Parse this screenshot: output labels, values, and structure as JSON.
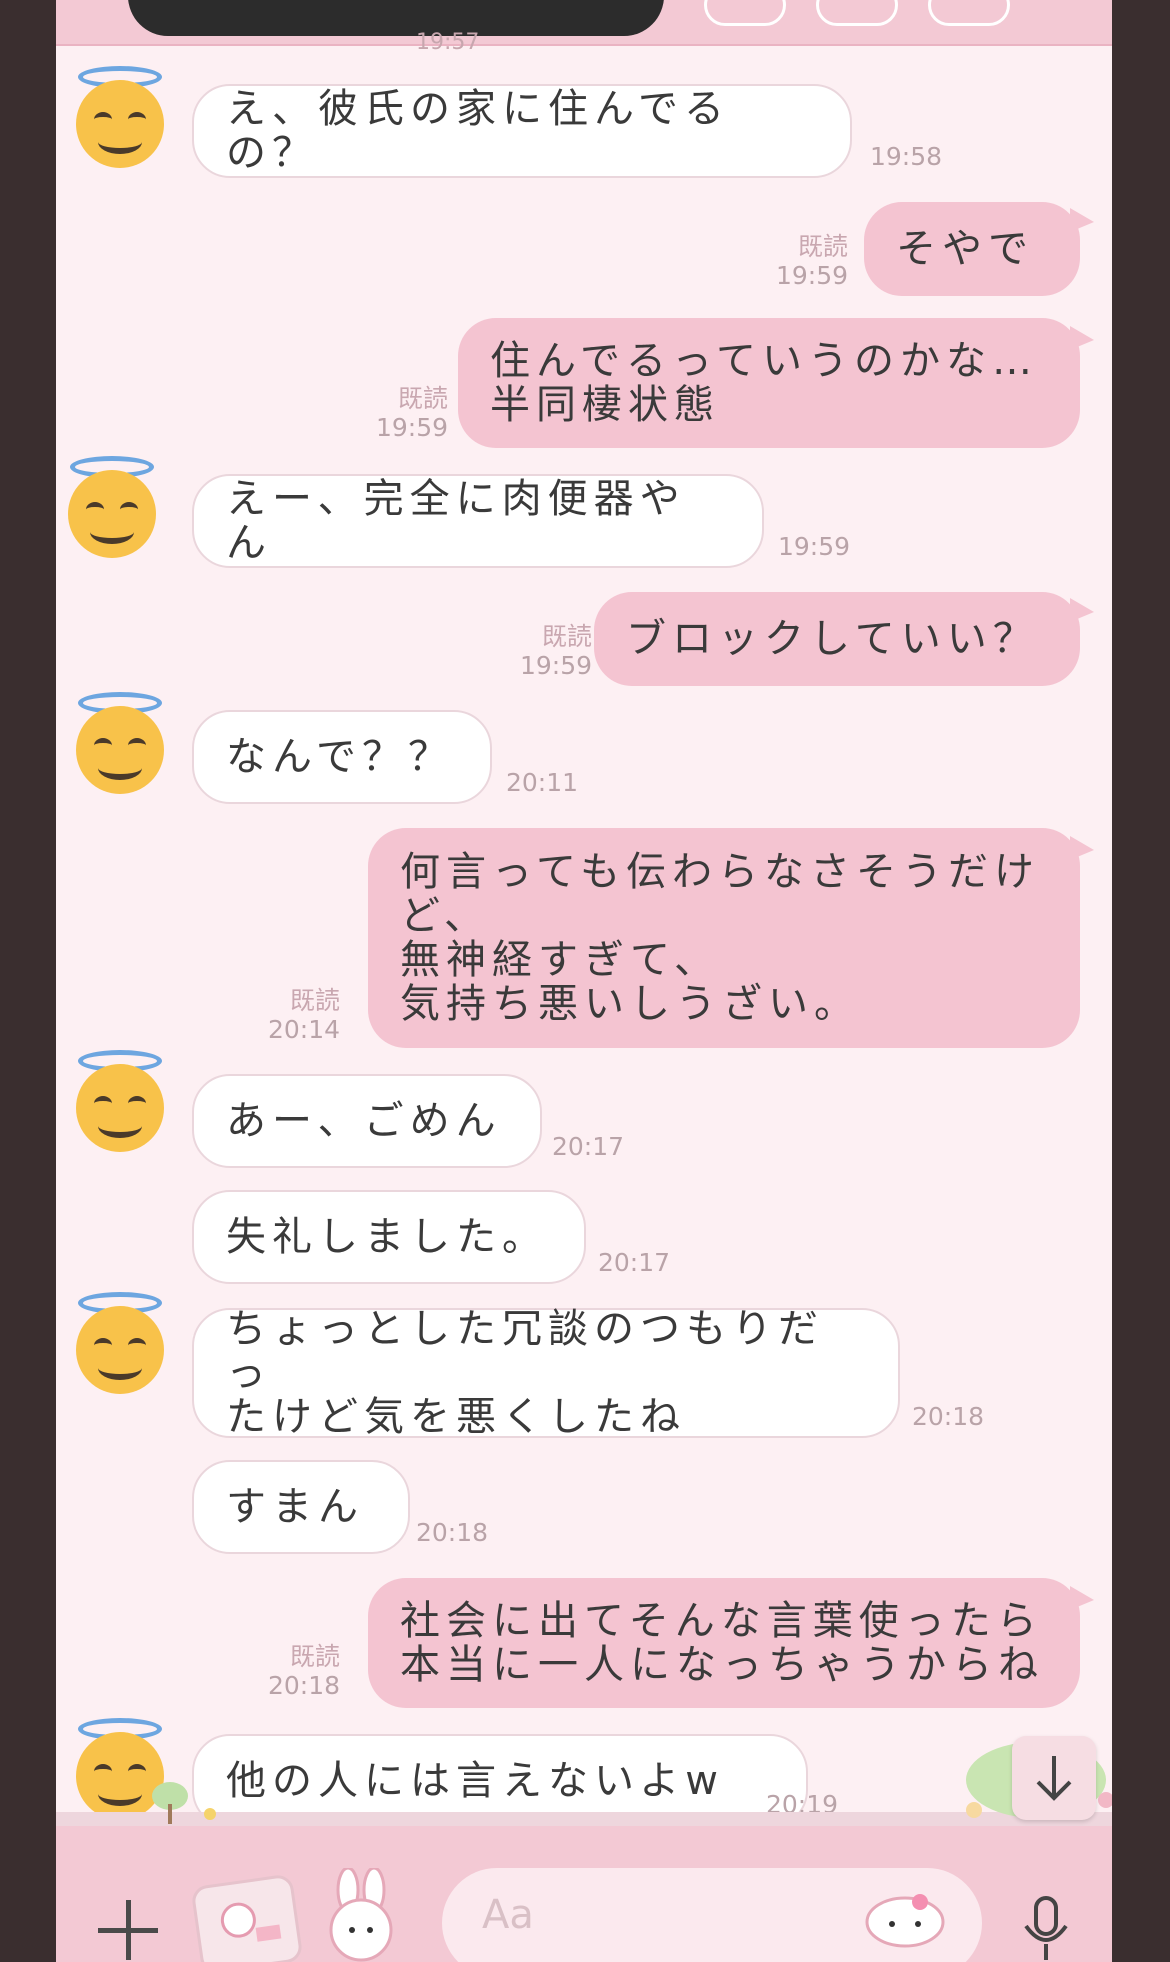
{
  "header": {
    "partial_time": "19:57"
  },
  "messages": [
    {
      "type": "incoming",
      "text": "え、彼氏の家に住んでるの？",
      "time": "19:58"
    },
    {
      "type": "outgoing",
      "text": "そやで",
      "read": "既読",
      "time": "19:59"
    },
    {
      "type": "outgoing",
      "text": "住んでるっていうのかな…\n半同棲状態",
      "read": "既読",
      "time": "19:59"
    },
    {
      "type": "incoming",
      "text": "えー、完全に肉便器やん",
      "time": "19:59"
    },
    {
      "type": "outgoing",
      "text": "ブロックしていい？",
      "read": "既読",
      "time": "19:59"
    },
    {
      "type": "incoming",
      "text": "なんで？？",
      "time": "20:11"
    },
    {
      "type": "outgoing",
      "text": "何言っても伝わらなさそうだけ\nど、\n無神経すぎて、\n気持ち悪いしうざい。",
      "read": "既読",
      "time": "20:14"
    },
    {
      "type": "incoming",
      "text": "あー、ごめん",
      "time": "20:17"
    },
    {
      "type": "incoming",
      "text": "失礼しました。",
      "time": "20:17"
    },
    {
      "type": "incoming",
      "text": "ちょっとした冗談のつもりだっ\nたけど気を悪くしたね",
      "time": "20:18"
    },
    {
      "type": "incoming",
      "text": "すまん",
      "time": "20:18"
    },
    {
      "type": "outgoing",
      "text": "社会に出てそんな言葉使ったら\n本当に一人になっちゃうからね",
      "read": "既読",
      "time": "20:18"
    },
    {
      "type": "incoming",
      "text": "他の人には言えないよw",
      "time": "20:19"
    }
  ],
  "composer": {
    "placeholder": "Aa"
  },
  "icons": {
    "plus": "plus-icon",
    "sticker": "sticker-icon",
    "bunny": "melody-bunny-icon",
    "emoji": "melody-emoji-icon",
    "mic": "microphone-icon",
    "scroll": "arrow-down-icon",
    "avatar": "halo-smiley-avatar"
  },
  "colors": {
    "background": "#fdf0f3",
    "outgoing_bubble": "#f4c4d1",
    "incoming_bubble": "#ffffff",
    "bar": "#f3c9d4",
    "timestamp": "#b9a3a8"
  }
}
